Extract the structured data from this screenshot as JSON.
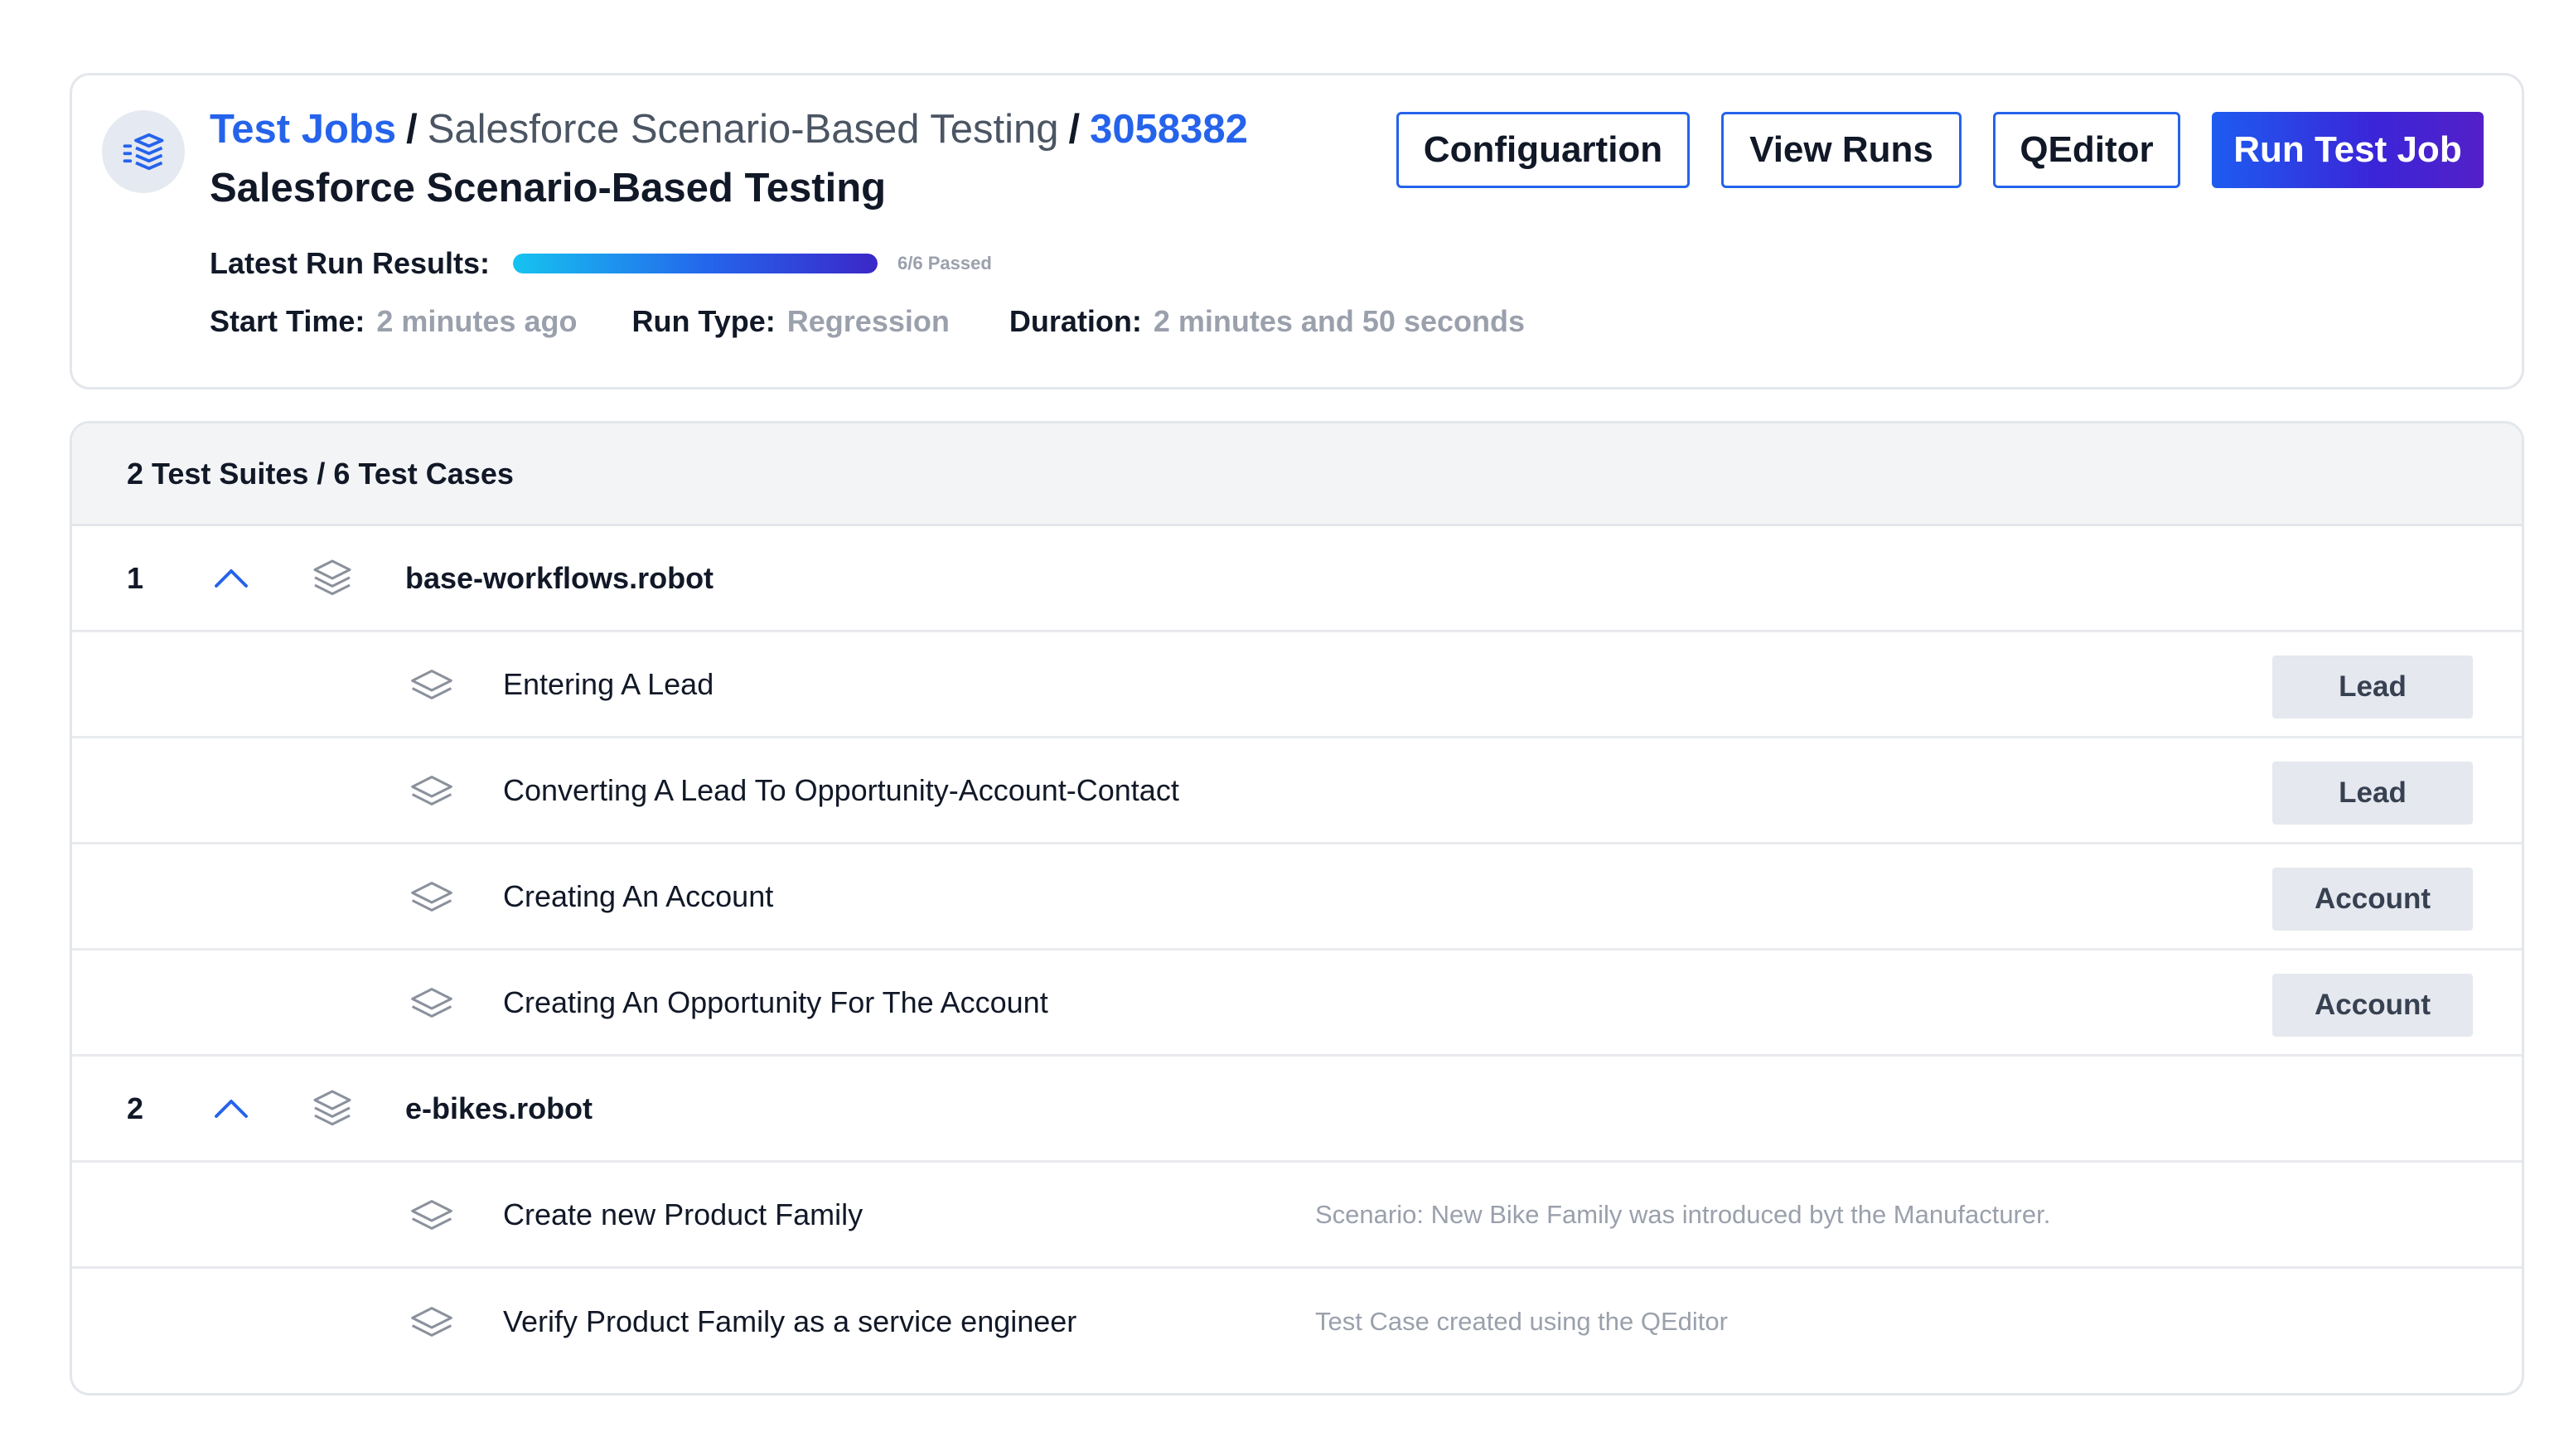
{
  "header": {
    "breadcrumb": {
      "root": "Test Jobs",
      "separator": "/",
      "job_name": "Salesforce Scenario-Based Testing",
      "job_id": "3058382"
    },
    "title": "Salesforce Scenario-Based Testing",
    "buttons": {
      "configuration": "Configuartion",
      "view_runs": "View Runs",
      "qeditor": "QEditor",
      "run": "Run Test Job"
    },
    "latest_run": {
      "label": "Latest Run Results:",
      "progress_fraction": 1.0,
      "progress_text": "6/6 Passed"
    },
    "meta": {
      "start_time_label": "Start Time:",
      "start_time_value": "2 minutes ago",
      "run_type_label": "Run Type:",
      "run_type_value": "Regression",
      "duration_label": "Duration:",
      "duration_value": "2 minutes and 50 seconds"
    }
  },
  "summary": "2 Test Suites / 6 Test Cases",
  "suites": [
    {
      "index": "1",
      "name": "base-workflows.robot",
      "cases": [
        {
          "name": "Entering A Lead",
          "tag": "Lead"
        },
        {
          "name": "Converting A Lead To Opportunity-Account-Contact",
          "tag": "Lead"
        },
        {
          "name": "Creating An Account",
          "tag": "Account"
        },
        {
          "name": "Creating An Opportunity For The Account",
          "tag": "Account"
        }
      ]
    },
    {
      "index": "2",
      "name": "e-bikes.robot",
      "cases": [
        {
          "name": "Create new Product Family",
          "description": "Scenario: New Bike Family was introduced byt the Manufacturer."
        },
        {
          "name": "Verify Product Family as a service engineer",
          "description": "Test Case created using the QEditor"
        }
      ]
    }
  ],
  "colors": {
    "accent": "#2563eb",
    "muted_text": "#9aa0ac",
    "tag_bg": "#e5e8ee"
  },
  "icons": {
    "job": "stacked-layers-icon",
    "chevron": "chevron-up-icon",
    "suite": "layers-icon",
    "case": "layer-icon"
  }
}
